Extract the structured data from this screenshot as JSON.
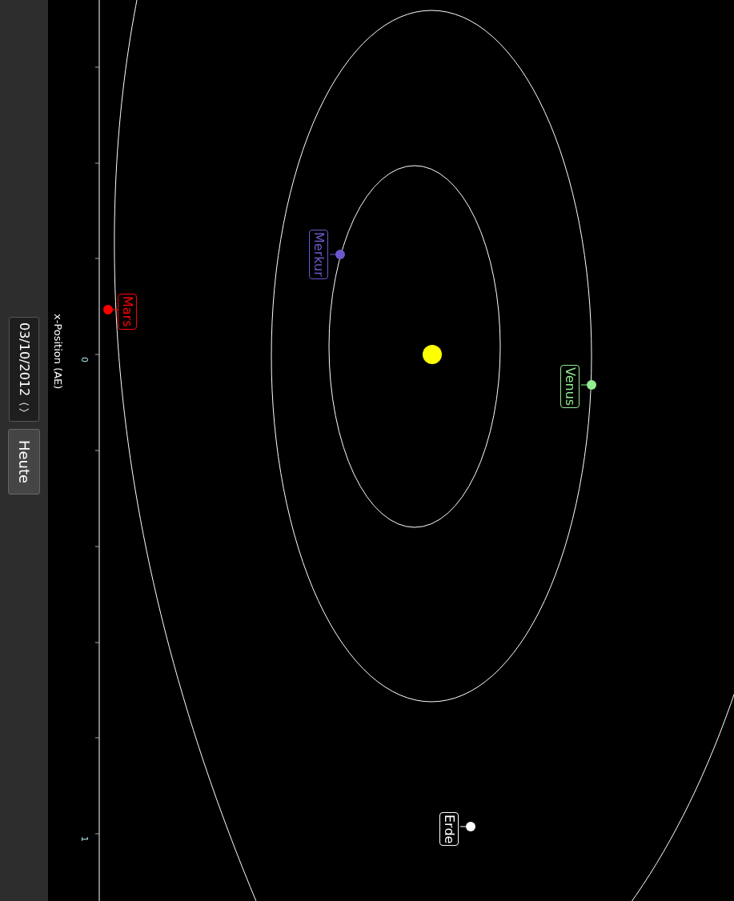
{
  "sidebar": {
    "date_field": {
      "value": "03/10/2012"
    },
    "today_button": {
      "label": "Heute"
    }
  },
  "axis": {
    "title": "x-Position (AE)",
    "tick_labels": [
      "0",
      "1"
    ]
  },
  "planets": [
    {
      "name": "Merkur",
      "color": "#6a5acd"
    },
    {
      "name": "Venus",
      "color": "#90ee90"
    },
    {
      "name": "Erde",
      "color": "#ffffff"
    },
    {
      "name": "Mars",
      "color": "#ff0000"
    }
  ]
}
